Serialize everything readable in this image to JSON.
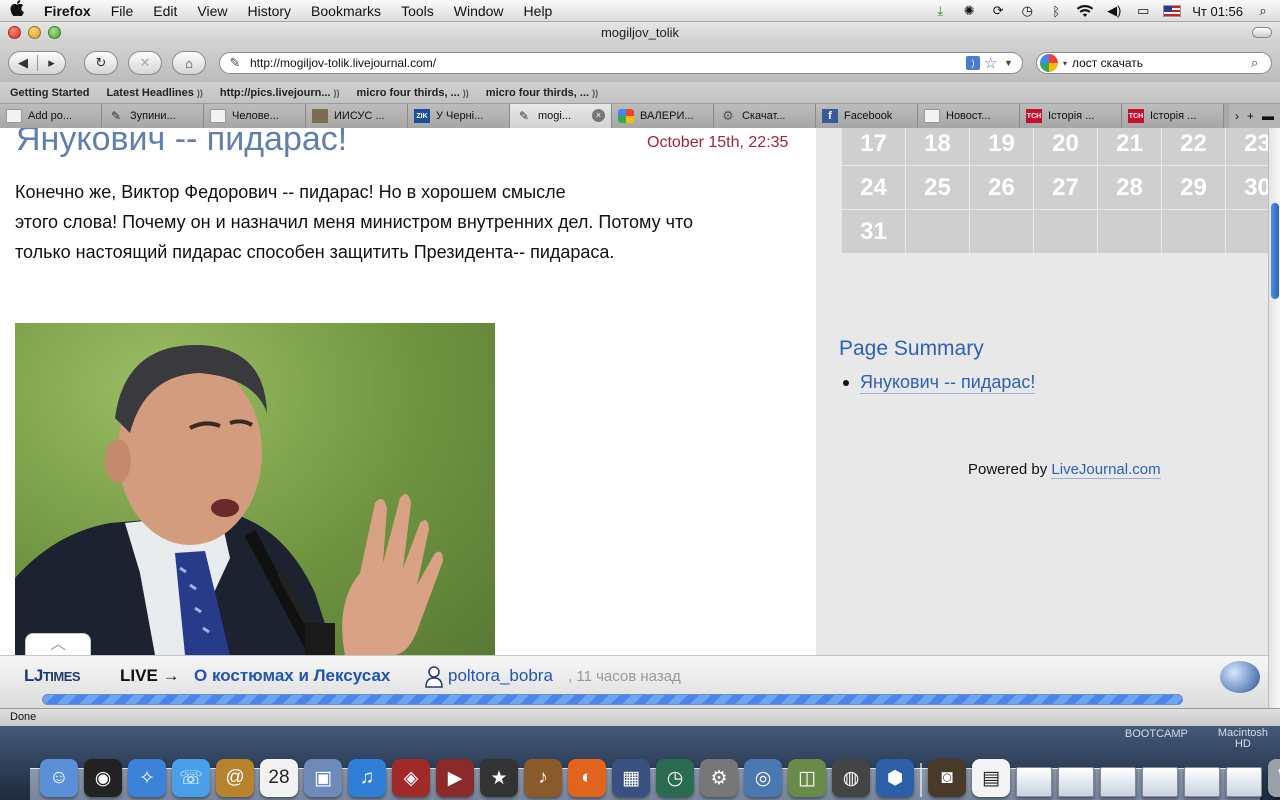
{
  "menubar": {
    "apple": "",
    "items": [
      "Firefox",
      "File",
      "Edit",
      "View",
      "History",
      "Bookmarks",
      "Tools",
      "Window",
      "Help"
    ],
    "clock": "Чт 01:56"
  },
  "window": {
    "title": "mogiljov_tolik"
  },
  "nav": {
    "url": "http://mogiljov-tolik.livejournal.com/",
    "search_value": "лост скачать"
  },
  "bookmarks": [
    {
      "label": "Getting Started",
      "feed": false
    },
    {
      "label": "Latest Headlines",
      "feed": true
    },
    {
      "label": "http://pics.livejourn...",
      "feed": true
    },
    {
      "label": "micro four thirds, ...",
      "feed": true
    },
    {
      "label": "micro four thirds, ...",
      "feed": true
    }
  ],
  "tabs": [
    {
      "label": "Add po...",
      "icon": "blank"
    },
    {
      "label": "Зупини...",
      "icon": "pencil"
    },
    {
      "label": "Челове...",
      "icon": "blank"
    },
    {
      "label": "ИИСУС ...",
      "icon": "img"
    },
    {
      "label": "У Черні...",
      "icon": "zik",
      "icon_text": "ZIK"
    },
    {
      "label": "mogi...",
      "icon": "pencil",
      "active": true
    },
    {
      "label": "ВАЛЕРИ...",
      "icon": "goog"
    },
    {
      "label": "Скачат...",
      "icon": "gear"
    },
    {
      "label": "Facebook",
      "icon": "fb",
      "icon_text": "f"
    },
    {
      "label": "Новост...",
      "icon": "blank"
    },
    {
      "label": "Історія ...",
      "icon": "tsn",
      "icon_text": "ТСН"
    },
    {
      "label": "Історія ...",
      "icon": "tsn",
      "icon_text": "ТСН"
    }
  ],
  "post": {
    "title": "Янукович -- пидарас!",
    "date": "October 15th, 22:35",
    "body_line1": "Конечно же, Виктор Федорович -- пидарас! Но в хорошем смысле",
    "body_line2": "этого слова! Почему он и назначил меня министром внутренних дел. Потому что",
    "body_line3": "только настоящий пидарас способен защитить Президента-- пидараса."
  },
  "calendar": {
    "rows": [
      [
        "17",
        "18",
        "19",
        "20",
        "21",
        "22",
        "23"
      ],
      [
        "24",
        "25",
        "26",
        "27",
        "28",
        "29",
        "30"
      ],
      [
        "31",
        "",
        "",
        "",
        "",
        "",
        ""
      ]
    ]
  },
  "summary": {
    "title": "Page Summary",
    "items": [
      "Янукович -- пидарас!"
    ]
  },
  "powered": {
    "prefix": "Powered by ",
    "link": "LiveJournal.com"
  },
  "ljtimes": {
    "logo_lj": "LJ",
    "logo_times": "TIMES",
    "live": "LIVE →",
    "headline": "О костюмах и Лексусах",
    "user": "poltora_bobra",
    "time": ", 11 часов назад",
    "progress": 1.0
  },
  "status": {
    "text": "Done"
  },
  "desktop": {
    "disk1": "BOOTCAMP",
    "disk2_line1": "Macintosh",
    "disk2_line2": "HD"
  },
  "dock": [
    {
      "name": "finder-icon",
      "color": "#5b8fd8",
      "glyph": "☺"
    },
    {
      "name": "dashboard-icon",
      "color": "#222",
      "glyph": "◉"
    },
    {
      "name": "safari-icon",
      "color": "#3b82d8",
      "glyph": "✧"
    },
    {
      "name": "ichat-icon",
      "color": "#4aa0e8",
      "glyph": "☏"
    },
    {
      "name": "address-book-icon",
      "color": "#b7832f",
      "glyph": "@"
    },
    {
      "name": "ical-icon",
      "color": "#f2f2f2",
      "glyph": "28",
      "dark": true
    },
    {
      "name": "iphoto-icon",
      "color": "#6d8ab8",
      "glyph": "▣"
    },
    {
      "name": "itunes-icon",
      "color": "#2f7fd8",
      "glyph": "♫"
    },
    {
      "name": "photo-booth-icon",
      "color": "#a02a2a",
      "glyph": "◈"
    },
    {
      "name": "imovie-icon",
      "color": "#8a2a2a",
      "glyph": "▶"
    },
    {
      "name": "iweb-icon",
      "color": "#333",
      "glyph": "★"
    },
    {
      "name": "garageband-icon",
      "color": "#8a5a2a",
      "glyph": "♪"
    },
    {
      "name": "firefox-icon",
      "color": "#e1631e",
      "glyph": "◐"
    },
    {
      "name": "spaces-icon",
      "color": "#3a5080",
      "glyph": "▦"
    },
    {
      "name": "time-machine-icon",
      "color": "#2b6b52",
      "glyph": "◷"
    },
    {
      "name": "system-preferences-icon",
      "color": "#777",
      "glyph": "⚙"
    },
    {
      "name": "preview-icon",
      "color": "#4a78b0",
      "glyph": "◎"
    },
    {
      "name": "image-capture-icon",
      "color": "#6a8a4a",
      "glyph": "◫"
    },
    {
      "name": "aperture-icon",
      "color": "#444",
      "glyph": "◍"
    },
    {
      "name": "xcode-icon",
      "color": "#2b5fa8",
      "glyph": "⬢"
    },
    {
      "name": "dock-separator",
      "sep": true
    },
    {
      "name": "photo-thumbnail-icon",
      "color": "#4a3a2a",
      "glyph": "◙"
    },
    {
      "name": "document-icon",
      "color": "#f4f4f4",
      "glyph": "▤",
      "dark": true
    },
    {
      "name": "minimized-window-1",
      "win": true
    },
    {
      "name": "minimized-window-2",
      "win": true
    },
    {
      "name": "minimized-window-3",
      "win": true
    },
    {
      "name": "minimized-window-4",
      "win": true
    },
    {
      "name": "minimized-window-5",
      "win": true
    },
    {
      "name": "minimized-window-6",
      "win": true
    },
    {
      "name": "trash-icon",
      "color": "#9aa0a8",
      "glyph": "🗑"
    }
  ]
}
